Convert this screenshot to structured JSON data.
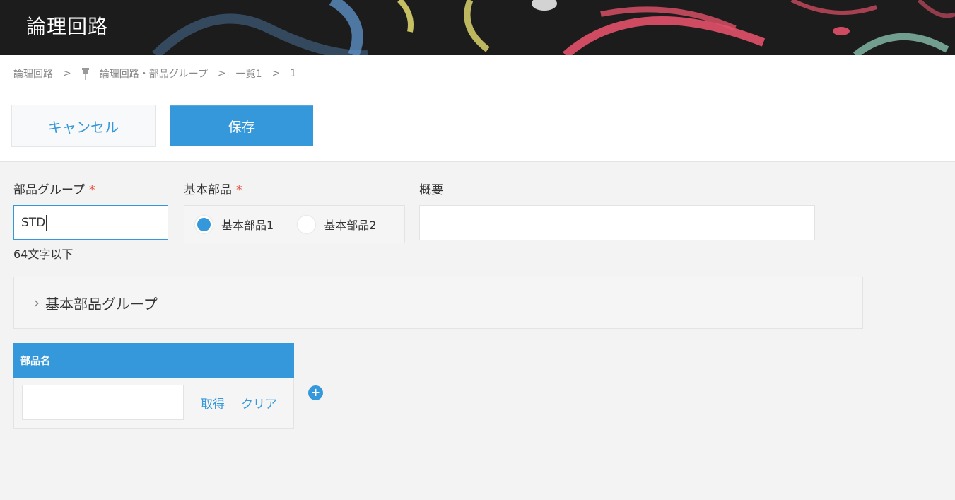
{
  "header": {
    "title": "論理回路"
  },
  "breadcrumb": {
    "items": [
      "論理回路",
      "論理回路・部品グループ",
      "一覧1",
      "1"
    ],
    "separator": ">"
  },
  "toolbar": {
    "cancel_label": "キャンセル",
    "save_label": "保存"
  },
  "form": {
    "group": {
      "label": "部品グループ",
      "required_mark": "*",
      "value": "STD",
      "hint": "64文字以下"
    },
    "base_part": {
      "label": "基本部品",
      "required_mark": "*",
      "options": [
        "基本部品1",
        "基本部品2"
      ],
      "selected": "基本部品1"
    },
    "summary": {
      "label": "概要",
      "value": ""
    }
  },
  "group_panel": {
    "title": "基本部品グループ"
  },
  "parts_table": {
    "header": "部品名",
    "row": {
      "value": "",
      "get_label": "取得",
      "clear_label": "クリア"
    },
    "add_label": "+"
  },
  "colors": {
    "accent": "#3498db",
    "required": "#e74c3c",
    "background": "#f3f3f3"
  }
}
